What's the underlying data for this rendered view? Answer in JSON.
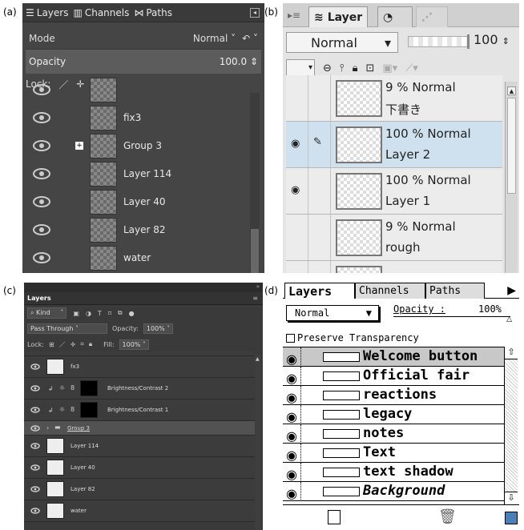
{
  "panel_a": {
    "label": "(a)",
    "tabs": [
      "Layers",
      "Channels",
      "Paths"
    ],
    "mode_label": "Mode",
    "mode_value": "Normal",
    "opacity_label": "Opacity",
    "opacity_value": "100.0",
    "lock_label": "Lock:",
    "layers": [
      "fix3",
      "Group 3",
      "Layer 114",
      "Layer 40",
      "Layer 82",
      "water"
    ]
  },
  "panel_b": {
    "label": "(b)",
    "tab_layer": "Layer",
    "blend_mode": "Normal",
    "opacity_value": "100",
    "layers": [
      {
        "line1": "9 % Normal",
        "line2": "下書き"
      },
      {
        "line1": "100 % Normal",
        "line2": "Layer 2"
      },
      {
        "line1": "100 % Normal",
        "line2": "Layer 1"
      },
      {
        "line1": "9 % Normal",
        "line2": "rough"
      }
    ]
  },
  "panel_c": {
    "label": "(c)",
    "tab": "Layers",
    "kind": "Kind",
    "blend": "Pass Through",
    "opacity_label": "Opacity:",
    "opacity_value": "100%",
    "lock_label": "Lock:",
    "fill_label": "Fill:",
    "fill_value": "100%",
    "layers": [
      "fx3",
      "Brightness/Contrast 2",
      "Brightness/Contrast 1",
      "Group 3",
      "Layer 114",
      "Layer 40",
      "Layer 82",
      "water"
    ]
  },
  "panel_d": {
    "label": "(d)",
    "tabs": [
      "Layers",
      "Channels",
      "Paths"
    ],
    "mode": "Normal",
    "opacity_label": "Opacity :",
    "opacity_value": "100%",
    "preserve_label": "Preserve Transparency",
    "layers": [
      "Welcome button",
      "Official fair",
      "reactions",
      "legacy",
      "notes",
      "Text",
      "text shadow",
      "Background"
    ]
  }
}
